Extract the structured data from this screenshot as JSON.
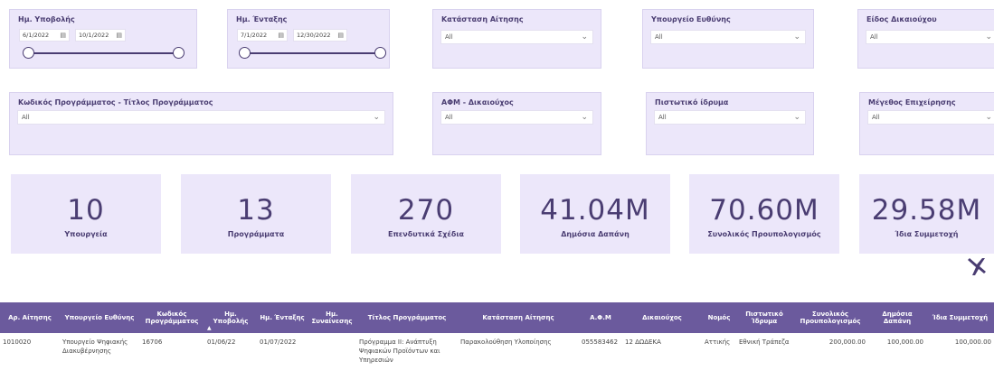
{
  "filters": {
    "submission_date": {
      "title": "Ημ. Υποβολής",
      "start": "6/1/2022",
      "end": "10/1/2022"
    },
    "inclusion_date": {
      "title": "Ημ. Ένταξης",
      "start": "7/1/2022",
      "end": "12/30/2022"
    },
    "status": {
      "title": "Κατάσταση Αίτησης",
      "value": "All"
    },
    "ministry": {
      "title": "Υπουργείο Ευθύνης",
      "value": "All"
    },
    "beneficiary_type": {
      "title": "Είδος Δικαιούχου",
      "value": "All"
    },
    "program": {
      "title": "Κωδικός Προγράμματος - Τίτλος Προγράμματος",
      "value": "All"
    },
    "afm": {
      "title": "ΑΦΜ - Δικαιούχος",
      "value": "All"
    },
    "bank": {
      "title": "Πιστωτικό ίδρυμα",
      "value": "All"
    },
    "company_size": {
      "title": "Μέγεθος Επιχείρησης",
      "value": "All"
    }
  },
  "kpis": [
    {
      "value": "10",
      "label": "Υπουργεία"
    },
    {
      "value": "13",
      "label": "Προγράμματα"
    },
    {
      "value": "270",
      "label": "Επενδυτικά Σχέδια"
    },
    {
      "value": "41.04M",
      "label": "Δημόσια Δαπάνη"
    },
    {
      "value": "70.60M",
      "label": "Συνολικός Προυπολογισμός"
    },
    {
      "value": "29.58M",
      "label": "Ίδια Συμμετοχή"
    }
  ],
  "table": {
    "headers": {
      "app_no": "Αρ. Αίτησης",
      "ministry": "Υπουργείο Ευθύνης",
      "program_code": "Κωδικός Προγράμματος",
      "submission": "Ημ. Υποβολής",
      "inclusion": "Ημ. Ένταξης",
      "agreement": "Ημ. Συναίνεσης",
      "program_title": "Τίτλος Προγράμματος",
      "status": "Κατάσταση Αίτησης",
      "afm": "Α.Φ.Μ",
      "beneficiary": "Δικαιούχος",
      "prefecture": "Νομός",
      "bank": "Πιστωτικό Ίδρυμα",
      "total_budget": "Συνολικός Προυπολογισμός",
      "public_exp": "Δημόσια Δαπάνη",
      "own_part": "Ίδια Συμμετοχή"
    },
    "row": {
      "app_no": "1010020",
      "ministry": "Υπουργείο Ψηφιακής Διακυβέρνησης",
      "program_code": "16706",
      "submission": "01/06/22",
      "inclusion": "01/07/2022",
      "agreement": "",
      "program_title": "Πρόγραμμα ΙΙ: Ανάπτυξη Ψηφιακών Προϊόντων και Υπηρεσιών",
      "status": "Παρακολούθηση Υλοποίησης",
      "afm": "055583462",
      "beneficiary": "12 ΔΩΔΕΚΑ",
      "prefecture": "Αττικής",
      "bank": "Εθνική Τράπεζα",
      "total_budget": "200,000.00",
      "public_exp": "100,000.00",
      "own_part": "100,000.00"
    }
  },
  "colors": {
    "accent": "#4a3d72",
    "panel": "#ece7fa",
    "header": "#6b5a9d"
  }
}
